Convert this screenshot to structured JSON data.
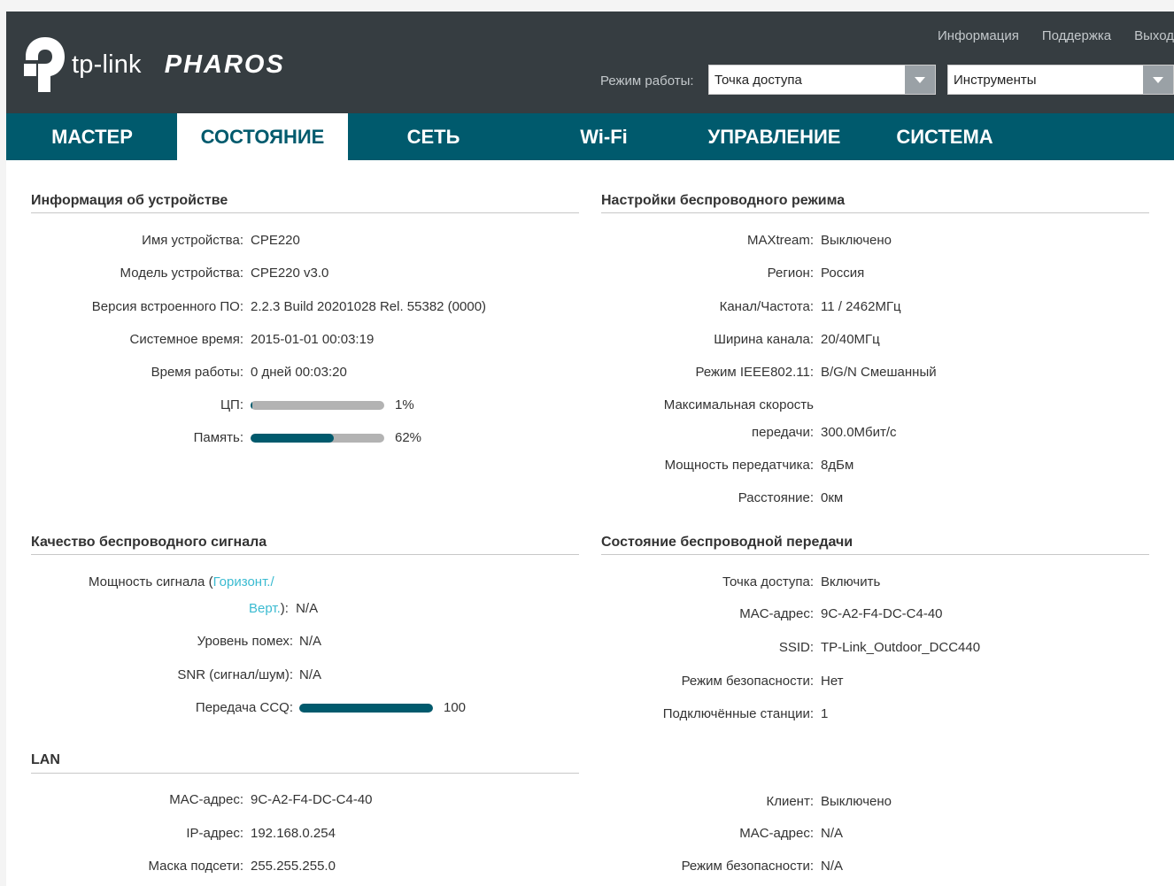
{
  "header": {
    "logo_text": "tp-link",
    "logo_product": "PHAROS",
    "links": [
      "Информация",
      "Поддержка",
      "Выход"
    ],
    "mode_label": "Режим работы:",
    "mode_value": "Точка доступа",
    "tools_value": "Инструменты"
  },
  "nav": {
    "tabs": [
      "МАСТЕР",
      "СОСТОЯНИЕ",
      "СЕТЬ",
      "Wi-Fi",
      "УПРАВЛЕНИЕ",
      "СИСТЕМА"
    ],
    "active_tab": "СОСТОЯНИЕ"
  },
  "device_info": {
    "title": "Информация об устройстве",
    "name_label": "Имя устройства:",
    "name": "CPE220",
    "model_label": "Модель устройства:",
    "model": "CPE220 v3.0",
    "fw_label": "Версия встроенного ПО:",
    "fw": "2.2.3 Build 20201028 Rel. 55382 (0000)",
    "time_label": "Системное время:",
    "time": "2015-01-01 00:03:19",
    "uptime_label": "Время работы:",
    "uptime": "0 дней 00:03:20",
    "cpu_label": "ЦП:",
    "cpu_text": "1%",
    "cpu_fraction": 0.01,
    "mem_label": "Память:",
    "mem_text": "62%",
    "mem_fraction": 0.62
  },
  "wireless_settings": {
    "title": "Настройки беспроводного режима",
    "maxtream_label": "MAXtream:",
    "maxtream": "Выключено",
    "region_label": "Регион:",
    "region": "Россия",
    "channel_label": "Канал/Частота:",
    "channel": "11 / 2462МГц",
    "width_label": "Ширина канала:",
    "width": "20/40МГц",
    "mode_label": "Режим IEEE802.11:",
    "mode": "B/G/N Смешанный",
    "rate_label_1": "Максимальная скорость",
    "rate_label_2": "передачи:",
    "rate": "300.0Мбит/с",
    "power_label": "Мощность передатчика:",
    "power": "8дБм",
    "distance_label": "Расстояние:",
    "distance": "0км"
  },
  "signal_quality": {
    "title": "Качество беспроводного сигнала",
    "strength_label_1": "Мощность сигнала (",
    "strength_link_1": "Горизонт./",
    "strength_link_2": "Верт.",
    "strength_label_2": "):",
    "strength": "N/A",
    "noise_label": "Уровень помех:",
    "noise": "N/A",
    "snr_label": "SNR (сигнал/шум):",
    "snr": "N/A",
    "ccq_label": "Передача CCQ:",
    "ccq_text": "100",
    "ccq_fraction": 1.0
  },
  "wireless_status": {
    "title": "Состояние беспроводной передачи",
    "ap_label": "Точка доступа:",
    "ap": "Включить",
    "mac_label": "MAC-адрес:",
    "mac": "9C-A2-F4-DC-C4-40",
    "ssid_label": "SSID:",
    "ssid": "TP-Link_Outdoor_DCC440",
    "security_label": "Режим безопасности:",
    "security": "Нет",
    "stations_label": "Подключённые станции:",
    "stations": "1",
    "client_label": "Клиент:",
    "client": "Выключено",
    "client_mac_label": "MAC-адрес:",
    "client_mac": "N/A",
    "client_security_label": "Режим безопасности:",
    "client_security": "N/A"
  },
  "lan": {
    "title": "LAN",
    "mac_label": "MAC-адрес:",
    "mac": "9C-A2-F4-DC-C4-40",
    "ip_label": "IP-адрес:",
    "ip": "192.168.0.254",
    "mask_label": "Маска подсети:",
    "mask": "255.255.255.0"
  },
  "colors": {
    "header_bg": "#363d41",
    "nav_bg": "#005a6d",
    "accent_link": "#3bbbd1",
    "bar_fill": "#005a6d",
    "bar_track": "#b3b3b3"
  }
}
